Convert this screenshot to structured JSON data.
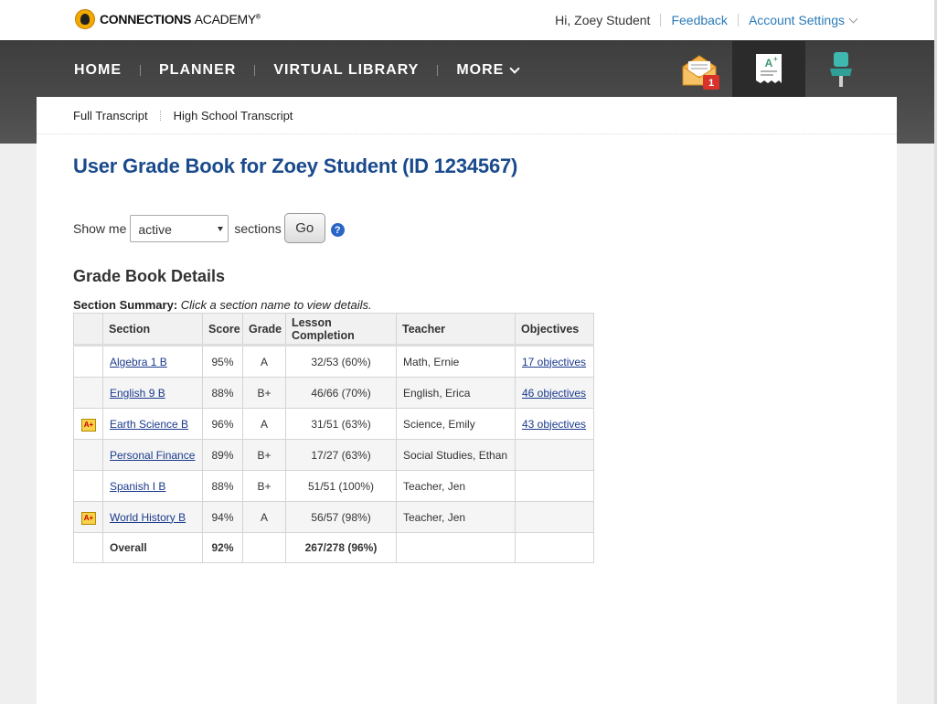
{
  "brand": {
    "name_bold": "CONNECTIONS",
    "name_light": "ACADEMY",
    "mark": "®"
  },
  "header": {
    "greeting": "Hi, Zoey Student",
    "feedback": "Feedback",
    "account": "Account Settings"
  },
  "nav": {
    "items": [
      "HOME",
      "PLANNER",
      "VIRTUAL LIBRARY",
      "MORE"
    ],
    "message_count": "1"
  },
  "subnav": [
    "Full Transcript",
    "High School Transcript"
  ],
  "page_title": "User Grade Book for Zoey Student (ID 1234567)",
  "filter": {
    "prefix": "Show me",
    "selected": "active",
    "suffix": "sections",
    "go": "Go",
    "help": "?"
  },
  "section_heading": "Grade Book Details",
  "summary": {
    "label": "Section Summary:",
    "hint": "Click a section name to view details."
  },
  "table": {
    "columns": [
      "",
      "Section",
      "Score",
      "Grade",
      "Lesson Completion",
      "Teacher",
      "Objectives"
    ],
    "rows": [
      {
        "badge": "",
        "section": "Algebra 1 B",
        "score": "95%",
        "grade": "A",
        "completion": "32/53 (60%)",
        "teacher": "Math, Ernie",
        "objectives": "17 objectives"
      },
      {
        "badge": "",
        "section": "English 9 B",
        "score": "88%",
        "grade": "B+",
        "completion": "46/66 (70%)",
        "teacher": "English, Erica",
        "objectives": "46 objectives"
      },
      {
        "badge": "A+",
        "section": "Earth Science B",
        "score": "96%",
        "grade": "A",
        "completion": "31/51 (63%)",
        "teacher": "Science, Emily",
        "objectives": "43 objectives"
      },
      {
        "badge": "",
        "section": "Personal Finance",
        "score": "89%",
        "grade": "B+",
        "completion": "17/27 (63%)",
        "teacher": "Social Studies, Ethan",
        "objectives": ""
      },
      {
        "badge": "",
        "section": "Spanish I B",
        "score": "88%",
        "grade": "B+",
        "completion": "51/51 (100%)",
        "teacher": "Teacher, Jen",
        "objectives": ""
      },
      {
        "badge": "A+",
        "section": "World History B",
        "score": "94%",
        "grade": "A",
        "completion": "56/57 (98%)",
        "teacher": "Teacher, Jen",
        "objectives": ""
      }
    ],
    "total": {
      "label": "Overall",
      "score": "92%",
      "completion": "267/278 (96%)"
    }
  },
  "colors": {
    "title": "#1a4a8c",
    "link": "#2a7ab8",
    "accent": "#5aa7d8",
    "nav_bg": "#444444"
  },
  "icons": [
    "logo-mark-icon",
    "message-envelope-icon",
    "grades-receipt-icon",
    "pushpin-icon",
    "help-icon",
    "achievement-badge-icon"
  ]
}
